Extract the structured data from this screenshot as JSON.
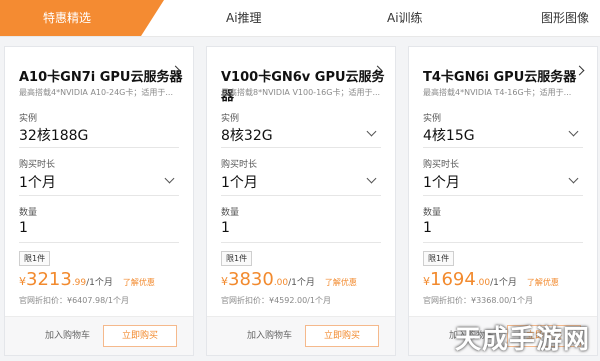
{
  "tabs": [
    "特惠精选",
    "Ai推理",
    "Ai训练",
    "图形图像"
  ],
  "labels": {
    "instance": "实例",
    "duration": "购买时长",
    "quantity": "数量",
    "limit": "限1件",
    "learn_more": "了解优惠",
    "add_cart": "加入购物车",
    "buy_now": "立即购买"
  },
  "cards": [
    {
      "title": "A10卡GN7i GPU云服务器",
      "subtitle": "最高搭载4*NVIDIA A10-24G卡；适用于...",
      "instance": "32核188G",
      "duration": "1个月",
      "quantity": "1",
      "price_yen": "¥",
      "price_int": "3213",
      "price_dec": ".99",
      "price_unit": "/1个月",
      "original": "官网折扣价：¥6407.98/1个月"
    },
    {
      "title": "V100卡GN6v GPU云服务器",
      "subtitle": "最高搭载8*NVIDIA V100-16G卡；适用于...",
      "instance": "8核32G",
      "duration": "1个月",
      "quantity": "1",
      "price_yen": "¥",
      "price_int": "3830",
      "price_dec": ".00",
      "price_unit": "/1个月",
      "original": "官网折扣价：¥4592.00/1个月"
    },
    {
      "title": "T4卡GN6i GPU云服务器",
      "subtitle": "最高搭载4*NVIDIA T4-16G卡；适用于...",
      "instance": "4核15G",
      "duration": "1个月",
      "quantity": "1",
      "price_yen": "¥",
      "price_int": "1694",
      "price_dec": ".00",
      "price_unit": "/1个月",
      "original": "官网折扣价：¥3368.00/1个月"
    }
  ],
  "watermark": "天成手游网",
  "colors": {
    "accent": "#f48b32",
    "price": "#f28a2e"
  }
}
